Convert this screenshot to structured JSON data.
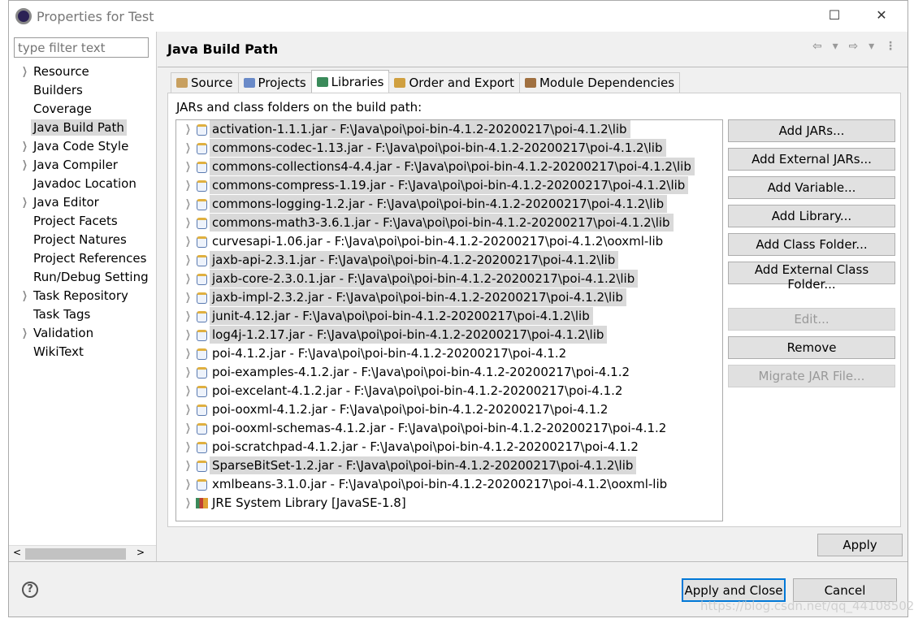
{
  "window": {
    "title": "Properties for Test",
    "minimize": "—",
    "maximize": "☐",
    "close": "✕"
  },
  "left": {
    "filter_placeholder": "type filter text",
    "items": [
      {
        "label": "Resource",
        "expandable": true
      },
      {
        "label": "Builders",
        "expandable": false
      },
      {
        "label": "Coverage",
        "expandable": false
      },
      {
        "label": "Java Build Path",
        "expandable": false,
        "selected": true
      },
      {
        "label": "Java Code Style",
        "expandable": true
      },
      {
        "label": "Java Compiler",
        "expandable": true
      },
      {
        "label": "Javadoc Location",
        "expandable": false
      },
      {
        "label": "Java Editor",
        "expandable": true
      },
      {
        "label": "Project Facets",
        "expandable": false
      },
      {
        "label": "Project Natures",
        "expandable": false
      },
      {
        "label": "Project References",
        "expandable": false
      },
      {
        "label": "Run/Debug Setting",
        "expandable": false
      },
      {
        "label": "Task Repository",
        "expandable": true
      },
      {
        "label": "Task Tags",
        "expandable": false
      },
      {
        "label": "Validation",
        "expandable": true
      },
      {
        "label": "WikiText",
        "expandable": false
      }
    ],
    "scroll_left": "<",
    "scroll_right": ">"
  },
  "page": {
    "title": "Java Build Path",
    "nav": "⇦ ▾ ⇨ ▾ ⋮",
    "tabs": [
      {
        "label": "Source"
      },
      {
        "label": "Projects"
      },
      {
        "label": "Libraries",
        "active": true
      },
      {
        "label": "Order and Export"
      },
      {
        "label": "Module Dependencies"
      }
    ],
    "list_label": "JARs and class folders on the build path:",
    "entries": [
      {
        "text": "activation-1.1.1.jar - F:\\Java\\poi\\poi-bin-4.1.2-20200217\\poi-4.1.2\\lib",
        "selected": true
      },
      {
        "text": "commons-codec-1.13.jar - F:\\Java\\poi\\poi-bin-4.1.2-20200217\\poi-4.1.2\\lib",
        "selected": true
      },
      {
        "text": "commons-collections4-4.4.jar - F:\\Java\\poi\\poi-bin-4.1.2-20200217\\poi-4.1.2\\lib",
        "selected": true
      },
      {
        "text": "commons-compress-1.19.jar - F:\\Java\\poi\\poi-bin-4.1.2-20200217\\poi-4.1.2\\lib",
        "selected": true
      },
      {
        "text": "commons-logging-1.2.jar - F:\\Java\\poi\\poi-bin-4.1.2-20200217\\poi-4.1.2\\lib",
        "selected": true
      },
      {
        "text": "commons-math3-3.6.1.jar - F:\\Java\\poi\\poi-bin-4.1.2-20200217\\poi-4.1.2\\lib",
        "selected": true
      },
      {
        "text": "curvesapi-1.06.jar - F:\\Java\\poi\\poi-bin-4.1.2-20200217\\poi-4.1.2\\ooxml-lib",
        "selected": false
      },
      {
        "text": "jaxb-api-2.3.1.jar - F:\\Java\\poi\\poi-bin-4.1.2-20200217\\poi-4.1.2\\lib",
        "selected": true
      },
      {
        "text": "jaxb-core-2.3.0.1.jar - F:\\Java\\poi\\poi-bin-4.1.2-20200217\\poi-4.1.2\\lib",
        "selected": true
      },
      {
        "text": "jaxb-impl-2.3.2.jar - F:\\Java\\poi\\poi-bin-4.1.2-20200217\\poi-4.1.2\\lib",
        "selected": true
      },
      {
        "text": "junit-4.12.jar - F:\\Java\\poi\\poi-bin-4.1.2-20200217\\poi-4.1.2\\lib",
        "selected": true
      },
      {
        "text": "log4j-1.2.17.jar - F:\\Java\\poi\\poi-bin-4.1.2-20200217\\poi-4.1.2\\lib",
        "selected": true
      },
      {
        "text": "poi-4.1.2.jar - F:\\Java\\poi\\poi-bin-4.1.2-20200217\\poi-4.1.2",
        "selected": false
      },
      {
        "text": "poi-examples-4.1.2.jar - F:\\Java\\poi\\poi-bin-4.1.2-20200217\\poi-4.1.2",
        "selected": false
      },
      {
        "text": "poi-excelant-4.1.2.jar - F:\\Java\\poi\\poi-bin-4.1.2-20200217\\poi-4.1.2",
        "selected": false
      },
      {
        "text": "poi-ooxml-4.1.2.jar - F:\\Java\\poi\\poi-bin-4.1.2-20200217\\poi-4.1.2",
        "selected": false
      },
      {
        "text": "poi-ooxml-schemas-4.1.2.jar - F:\\Java\\poi\\poi-bin-4.1.2-20200217\\poi-4.1.2",
        "selected": false
      },
      {
        "text": "poi-scratchpad-4.1.2.jar - F:\\Java\\poi\\poi-bin-4.1.2-20200217\\poi-4.1.2",
        "selected": false
      },
      {
        "text": "SparseBitSet-1.2.jar - F:\\Java\\poi\\poi-bin-4.1.2-20200217\\poi-4.1.2\\lib",
        "selected": true
      },
      {
        "text": "xmlbeans-3.1.0.jar - F:\\Java\\poi\\poi-bin-4.1.2-20200217\\poi-4.1.2\\ooxml-lib",
        "selected": false
      },
      {
        "text": "JRE System Library [JavaSE-1.8]",
        "selected": false,
        "icon": "library-icon"
      }
    ],
    "buttons": [
      {
        "label": "Add JARs...",
        "enabled": true
      },
      {
        "label": "Add External JARs...",
        "enabled": true
      },
      {
        "label": "Add Variable...",
        "enabled": true
      },
      {
        "label": "Add Library...",
        "enabled": true
      },
      {
        "label": "Add Class Folder...",
        "enabled": true
      },
      {
        "label": "Add External Class Folder...",
        "enabled": true
      },
      {
        "label": "Edit...",
        "enabled": false
      },
      {
        "label": "Remove",
        "enabled": true
      },
      {
        "label": "Migrate JAR File...",
        "enabled": false
      }
    ],
    "apply": "Apply"
  },
  "footer": {
    "help": "?",
    "apply_close": "Apply and Close",
    "cancel": "Cancel"
  },
  "watermark": "https://blog.csdn.net/qq_44108502"
}
